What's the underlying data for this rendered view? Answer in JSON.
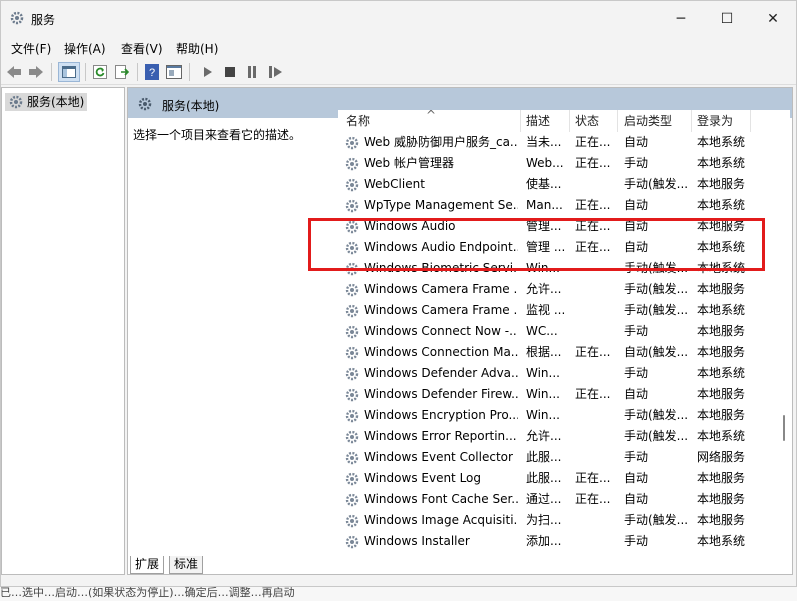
{
  "title": "服务",
  "window_controls": {
    "minimize": "─",
    "maximize": "☐",
    "close": "✕"
  },
  "menu": [
    "文件(F)",
    "操作(A)",
    "查看(V)",
    "帮助(H)"
  ],
  "tree": {
    "item": "服务(本地)"
  },
  "panel": {
    "header": "服务(本地)",
    "description": "选择一个项目来查看它的描述。"
  },
  "columns": [
    "名称",
    "描述",
    "状态",
    "启动类型",
    "登录为"
  ],
  "sort_indicator": "^",
  "rows": [
    {
      "name": "Web 威胁防御用户服务_ca...",
      "desc": "当未...",
      "status": "正在...",
      "startup": "自动",
      "logon": "本地系统"
    },
    {
      "name": "Web 帐户管理器",
      "desc": "Web...",
      "status": "正在...",
      "startup": "手动",
      "logon": "本地系统"
    },
    {
      "name": "WebClient",
      "desc": "使基...",
      "status": "",
      "startup": "手动(触发...",
      "logon": "本地服务"
    },
    {
      "name": "WpType Management Se...",
      "desc": "Man...",
      "status": "正在...",
      "startup": "自动",
      "logon": "本地系统"
    },
    {
      "name": "Windows Audio",
      "desc": "管理...",
      "status": "正在...",
      "startup": "自动",
      "logon": "本地服务"
    },
    {
      "name": "Windows Audio Endpoint...",
      "desc": "管理 ...",
      "status": "正在...",
      "startup": "自动",
      "logon": "本地系统"
    },
    {
      "name": "Windows Biometric Servi...",
      "desc": "Win...",
      "status": "",
      "startup": "手动(触发...",
      "logon": "本地系统"
    },
    {
      "name": "Windows Camera Frame ...",
      "desc": "允许...",
      "status": "",
      "startup": "手动(触发...",
      "logon": "本地服务"
    },
    {
      "name": "Windows Camera Frame ...",
      "desc": "监视 ...",
      "status": "",
      "startup": "手动(触发...",
      "logon": "本地系统"
    },
    {
      "name": "Windows Connect Now -...",
      "desc": "WC...",
      "status": "",
      "startup": "手动",
      "logon": "本地服务"
    },
    {
      "name": "Windows Connection Ma...",
      "desc": "根据...",
      "status": "正在...",
      "startup": "自动(触发...",
      "logon": "本地服务"
    },
    {
      "name": "Windows Defender Adva...",
      "desc": "Win...",
      "status": "",
      "startup": "手动",
      "logon": "本地系统"
    },
    {
      "name": "Windows Defender Firew...",
      "desc": "Win...",
      "status": "正在...",
      "startup": "自动",
      "logon": "本地服务"
    },
    {
      "name": "Windows Encryption Pro...",
      "desc": "Win...",
      "status": "",
      "startup": "手动(触发...",
      "logon": "本地服务"
    },
    {
      "name": "Windows Error Reportin...",
      "desc": "允许...",
      "status": "",
      "startup": "手动(触发...",
      "logon": "本地系统"
    },
    {
      "name": "Windows Event Collector",
      "desc": "此服...",
      "status": "",
      "startup": "手动",
      "logon": "网络服务"
    },
    {
      "name": "Windows Event Log",
      "desc": "此服...",
      "status": "正在...",
      "startup": "自动",
      "logon": "本地服务"
    },
    {
      "name": "Windows Font Cache Ser...",
      "desc": "通过...",
      "status": "正在...",
      "startup": "自动",
      "logon": "本地服务"
    },
    {
      "name": "Windows Image Acquisiti...",
      "desc": "为扫...",
      "status": "",
      "startup": "手动(触发...",
      "logon": "本地服务"
    },
    {
      "name": "Windows Installer",
      "desc": "添加...",
      "status": "",
      "startup": "手动",
      "logon": "本地系统"
    }
  ],
  "tabs": [
    "扩展",
    "标准"
  ],
  "bottom_strip": "已…选中…启动…(如果状态为停止)…确定后…调整…再启动",
  "colors": {
    "header_bg": "#b7c8da",
    "highlight": "#e21b1b"
  }
}
